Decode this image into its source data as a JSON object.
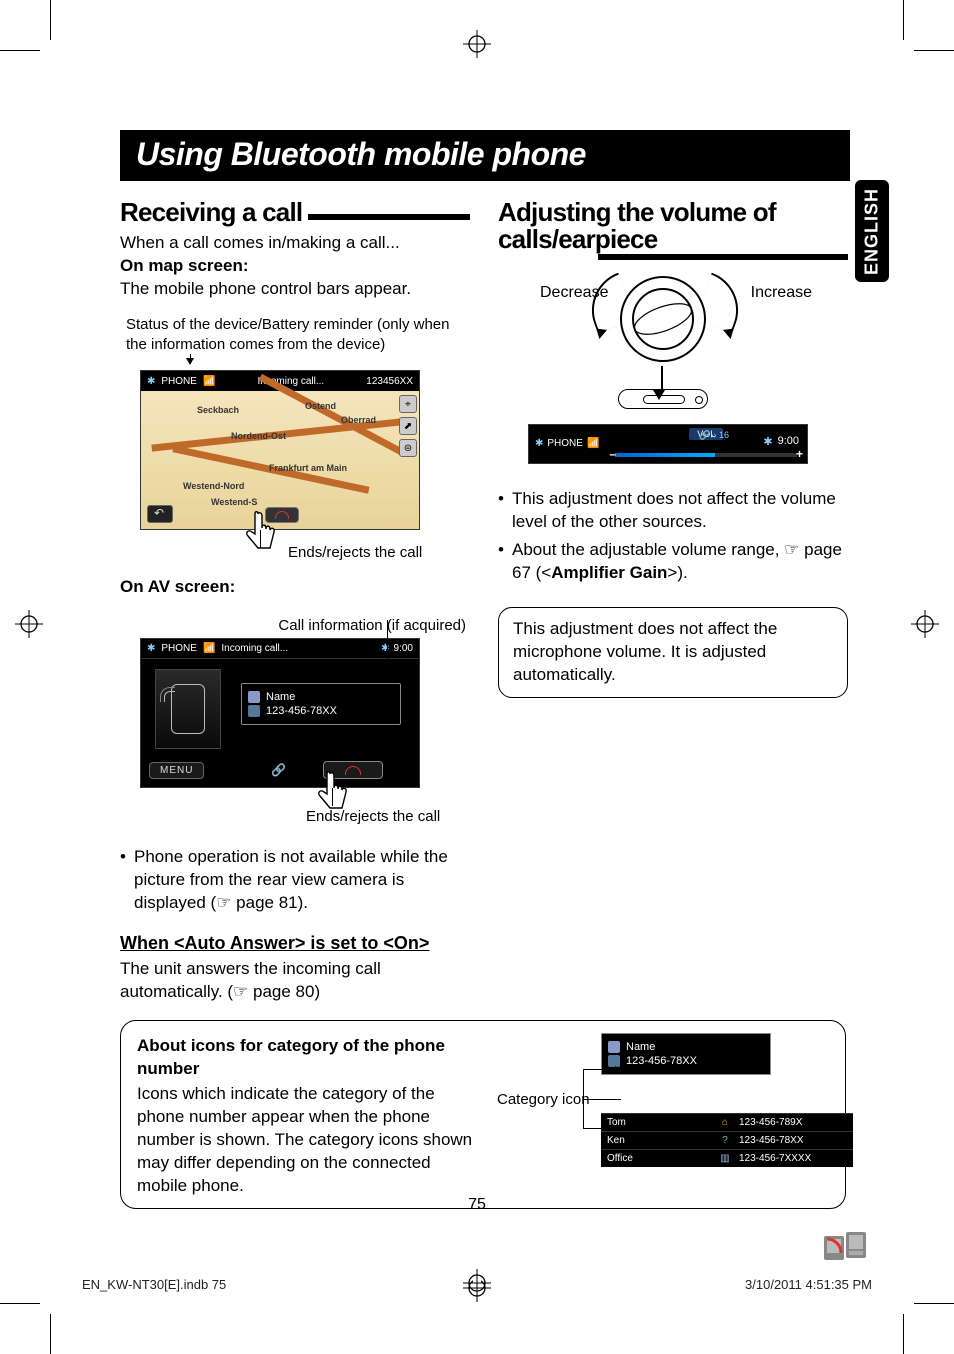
{
  "page": {
    "title": "Using Bluetooth mobile phone",
    "language_tab": "ENGLISH",
    "number": "75"
  },
  "left": {
    "heading": "Receiving a call",
    "intro": "When a call comes in/making a call...",
    "map_label": "On map screen:",
    "map_body": "The mobile phone control bars appear.",
    "status_note": "Status of the device/Battery reminder (only when the information comes from the device)",
    "ends_label": "Ends/rejects the call",
    "av_label": "On AV screen:",
    "av_caption": "Call information (if acquired)",
    "bullet_rear_cam": "Phone operation is not available while the picture from the rear view camera is displayed (☞ page 81).",
    "sub_heading": "When <Auto Answer> is set to <On>",
    "sub_body": "The unit answers the incoming call automatically. (☞ page 80)",
    "map_shot": {
      "bar_phone": "PHONE",
      "bar_incoming": "Incoming call...",
      "bar_number": "123456XX",
      "places": [
        "Seckbach",
        "Ostend",
        "Oberrad",
        "Nordend-Ost",
        "Frankfurt am Main",
        "Westend-Nord",
        "Westend-S"
      ]
    },
    "av_shot": {
      "bar_phone": "PHONE",
      "bar_incoming": "Incoming call...",
      "clock": "9:00",
      "name_row": "Name",
      "number_row": "123-456-78XX",
      "menu": "MENU"
    }
  },
  "right": {
    "heading": "Adjusting the volume of calls/earpiece",
    "decrease": "Decrease",
    "increase": "Increase",
    "bar": {
      "phone": "PHONE",
      "vol": "VOL",
      "handsfree": "16",
      "clock": "9:00"
    },
    "bullets": [
      "This adjustment does not affect the volume level of the other sources.",
      "About the adjustable volume range, ☞ page 67 (<Amplifier Gain>)."
    ],
    "bullet_bold": "Amplifier Gain",
    "note": "This adjustment does not affect the microphone volume. It is adjusted automatically."
  },
  "about": {
    "heading": "About icons for category of the phone number",
    "body": "Icons which indicate the category of the phone number appear when the phone number is shown. The category icons shown may differ depending on the connected mobile phone.",
    "category_label": "Category icon",
    "sample_name": "Name",
    "sample_number": "123-456-78XX",
    "list": [
      {
        "name": "Tom",
        "icon": "home",
        "number": "123-456-789X"
      },
      {
        "name": "Ken",
        "icon": "unknown",
        "number": "123-456-78XX"
      },
      {
        "name": "Office",
        "icon": "office",
        "number": "123-456-7XXXX"
      }
    ]
  },
  "footer": {
    "file": "EN_KW-NT30[E].indb   75",
    "timestamp": "3/10/2011   4:51:35 PM"
  }
}
